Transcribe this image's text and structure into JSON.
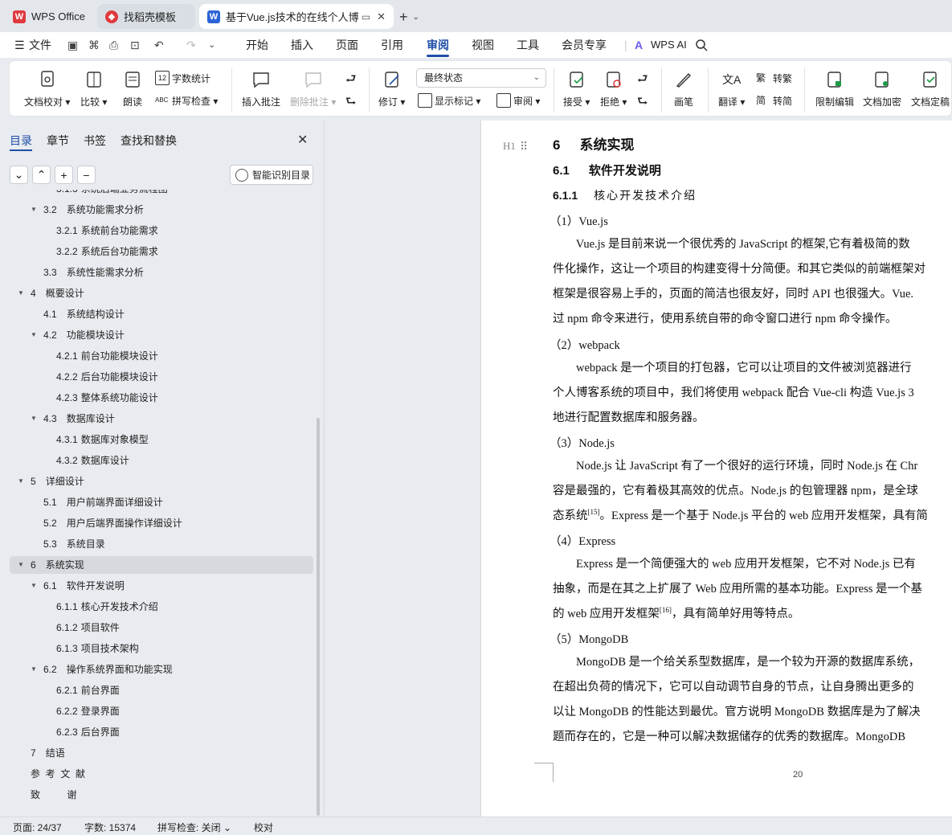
{
  "tabs": {
    "wps_office": "WPS Office",
    "template": "找稻壳模板",
    "document": "基于Vue.js技术的在线个人博客"
  },
  "menu": {
    "file": "文件",
    "items": [
      "开始",
      "插入",
      "页面",
      "引用",
      "审阅",
      "视图",
      "工具",
      "会员专享"
    ],
    "wps_ai": "WPS AI"
  },
  "ribbon": {
    "doc_proofread": "文档校对",
    "compare": "比较",
    "read_aloud": "朗读",
    "word_count": "字数统计",
    "spell_check": "拼写检查",
    "insert_comment": "插入批注",
    "delete_comment": "删除批注",
    "revise": "修订",
    "state": "最终状态",
    "show_markup": "显示标记",
    "review": "审阅",
    "accept": "接受",
    "reject": "拒绝",
    "pen": "画笔",
    "translate": "翻译",
    "to_traditional": "转繁",
    "to_simplified": "转简",
    "restrict_edit": "限制编辑",
    "doc_encrypt": "文档加密",
    "doc_finalize": "文档定稿"
  },
  "panel": {
    "tabs": [
      "目录",
      "章节",
      "书签",
      "查找和替换"
    ],
    "smart_toc": "智能识别目录",
    "toc": [
      {
        "num": "3.1.3",
        "label": "系统后端业务流程图",
        "level": 3,
        "collapsible": false
      },
      {
        "num": "3.2",
        "label": "系统功能需求分析",
        "level": 2,
        "collapsible": true
      },
      {
        "num": "3.2.1",
        "label": "系统前台功能需求",
        "level": 3,
        "collapsible": false
      },
      {
        "num": "3.2.2",
        "label": "系统后台功能需求",
        "level": 3,
        "collapsible": false
      },
      {
        "num": "3.3",
        "label": "系统性能需求分析",
        "level": 2,
        "collapsible": false
      },
      {
        "num": "4",
        "label": "概要设计",
        "level": 1,
        "collapsible": true
      },
      {
        "num": "4.1",
        "label": "系统结构设计",
        "level": 2,
        "collapsible": false
      },
      {
        "num": "4.2",
        "label": "功能模块设计",
        "level": 2,
        "collapsible": true
      },
      {
        "num": "4.2.1",
        "label": "前台功能模块设计",
        "level": 3,
        "collapsible": false
      },
      {
        "num": "4.2.2",
        "label": "后台功能模块设计",
        "level": 3,
        "collapsible": false
      },
      {
        "num": "4.2.3",
        "label": "整体系统功能设计",
        "level": 3,
        "collapsible": false
      },
      {
        "num": "4.3",
        "label": "数据库设计",
        "level": 2,
        "collapsible": true
      },
      {
        "num": "4.3.1",
        "label": "数据库对象模型",
        "level": 3,
        "collapsible": false
      },
      {
        "num": "4.3.2",
        "label": "数据库设计",
        "level": 3,
        "collapsible": false
      },
      {
        "num": "5",
        "label": "详细设计",
        "level": 1,
        "collapsible": true
      },
      {
        "num": "5.1",
        "label": "用户前端界面详细设计",
        "level": 2,
        "collapsible": false
      },
      {
        "num": "5.2",
        "label": "用户后端界面操作详细设计",
        "level": 2,
        "collapsible": false
      },
      {
        "num": "5.3",
        "label": "系统目录",
        "level": 2,
        "collapsible": false
      },
      {
        "num": "6",
        "label": "系统实现",
        "level": 1,
        "collapsible": true,
        "selected": true
      },
      {
        "num": "6.1",
        "label": "软件开发说明",
        "level": 2,
        "collapsible": true
      },
      {
        "num": "6.1.1",
        "label": "核心开发技术介绍",
        "level": 3,
        "collapsible": false
      },
      {
        "num": "6.1.2",
        "label": "项目软件",
        "level": 3,
        "collapsible": false
      },
      {
        "num": "6.1.3",
        "label": "项目技术架构",
        "level": 3,
        "collapsible": false
      },
      {
        "num": "6.2",
        "label": "操作系统界面和功能实现",
        "level": 2,
        "collapsible": true
      },
      {
        "num": "6.2.1",
        "label": "前台界面",
        "level": 3,
        "collapsible": false
      },
      {
        "num": "6.2.2",
        "label": "登录界面",
        "level": 3,
        "collapsible": false
      },
      {
        "num": "6.2.3",
        "label": "后台界面",
        "level": 3,
        "collapsible": false
      },
      {
        "num": "7",
        "label": "结语",
        "level": 1,
        "collapsible": false
      },
      {
        "num": "",
        "label": "参  考  文  献",
        "level": 1,
        "collapsible": false
      },
      {
        "num": "",
        "label": "致          谢",
        "level": 1,
        "collapsible": false
      }
    ]
  },
  "doc": {
    "heading_num": "6",
    "heading": "系统实现",
    "sub_num": "6.1",
    "sub": "软件开发说明",
    "subsub_num": "6.1.1",
    "subsub": "核心开发技术介绍",
    "lines": [
      "（1）Vue.js",
      "        Vue.js 是目前来说一个很优秀的 JavaScript 的框架,它有着极简的数",
      "件化操作，这让一个项目的构建变得十分简便。和其它类似的前端框架对",
      "框架是很容易上手的，页面的简洁也很友好，同时 API 也很强大。Vue.",
      "过 npm 命令来进行，使用系统自带的命令窗口进行 npm 命令操作。",
      "（2）webpack",
      "        webpack 是一个项目的打包器，它可以让项目的文件被浏览器进行",
      "个人博客系统的项目中，我们将使用 webpack 配合 Vue-cli 构造 Vue.js 3",
      "地进行配置数据库和服务器。",
      "（3）Node.js",
      "        Node.js 让 JavaScript 有了一个很好的运行环境，同时 Node.js 在 Chr",
      "容是最强的，它有着极其高效的优点。Node.js 的包管理器 npm，是全球",
      "态系统[15]。Express 是一个基于 Node.js 平台的 web 应用开发框架，具有简",
      "（4）Express",
      "        Express 是一个简便强大的 web 应用开发框架，它不对 Node.js 已有",
      "抽象，而是在其之上扩展了 Web 应用所需的基本功能。Express 是一个基",
      "的 web 应用开发框架[16]，具有简单好用等特点。",
      "（5）MongoDB",
      "        MongoDB 是一个给关系型数据库，是一个较为开源的数据库系统，",
      "在超出负荷的情况下，它可以自动调节自身的节点，让自身腾出更多的",
      "以让 MongoDB 的性能达到最优。官方说明 MongoDB 数据库是为了解决",
      "题而存在的，它是一种可以解决数据储存的优秀的数据库。MongoDB"
    ],
    "page_number": "20",
    "heading_marker": "H1"
  },
  "status": {
    "page": "页面: 24/37",
    "words": "字数: 15374",
    "spell": "拼写检查: 关闭",
    "proof": "校对"
  },
  "colors": {
    "accent": "#1f4ea8",
    "wps_red": "#e0393e",
    "word_blue": "#2b64d8"
  }
}
